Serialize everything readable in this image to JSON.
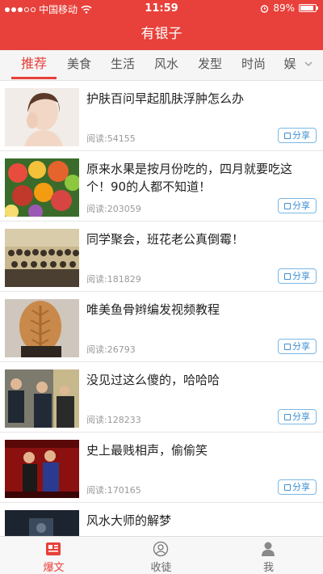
{
  "status_bar": {
    "carrier": "中国移动",
    "time": "11:59",
    "battery": "89%",
    "battery_level": 0.89
  },
  "app": {
    "title": "有银子"
  },
  "tabs": [
    {
      "label": "推荐",
      "active": true
    },
    {
      "label": "美食"
    },
    {
      "label": "生活"
    },
    {
      "label": "风水"
    },
    {
      "label": "发型"
    },
    {
      "label": "时尚"
    },
    {
      "label": "娱"
    }
  ],
  "feed": [
    {
      "title": "护肤百问早起肌肤浮肿怎么办",
      "reads": "阅读:54155",
      "share": "分享"
    },
    {
      "title": "原来水果是按月份吃的，四月就要吃这个！90的人都不知道！",
      "reads": "阅读:203059",
      "share": "分享"
    },
    {
      "title": "同学聚会，班花老公真倒霉！",
      "reads": "阅读:181829",
      "share": "分享"
    },
    {
      "title": "唯美鱼骨辫编发视频教程",
      "reads": "阅读:26793",
      "share": "分享"
    },
    {
      "title": "没见过这么傻的，哈哈哈",
      "reads": "阅读:128233",
      "share": "分享"
    },
    {
      "title": "史上最贱相声，偷偷笑",
      "reads": "阅读:170165",
      "share": "分享"
    },
    {
      "title": "风水大师的解梦",
      "reads": "",
      "share": ""
    }
  ],
  "bottom_nav": [
    {
      "label": "爆文",
      "icon": "article-icon",
      "active": true
    },
    {
      "label": "收徒",
      "icon": "apprentice-icon"
    },
    {
      "label": "我",
      "icon": "profile-icon"
    }
  ],
  "colors": {
    "accent": "#e8403a",
    "share_blue": "#3f8fd2"
  }
}
